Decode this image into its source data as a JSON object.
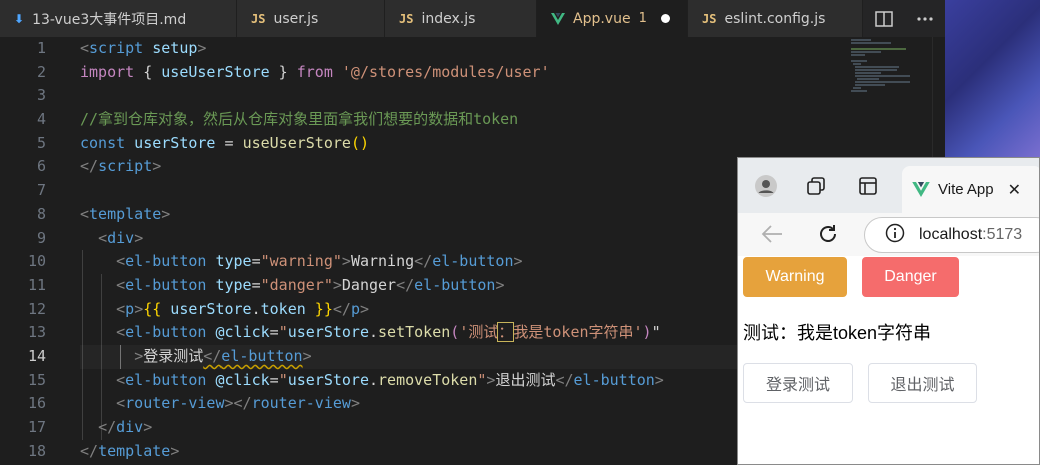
{
  "editor_tabs": [
    {
      "label": "13-vue3大事件项目.md",
      "icon": "markdown-icon"
    },
    {
      "label": "user.js",
      "icon": "js-icon",
      "badge": "JS"
    },
    {
      "label": "index.js",
      "icon": "js-icon",
      "badge": "JS"
    },
    {
      "label": "App.vue",
      "icon": "vue-icon",
      "modified_count": "1",
      "active": true
    },
    {
      "label": "eslint.config.js",
      "icon": "js-icon",
      "badge": "JS"
    }
  ],
  "tab_actions": [
    "split-editor-icon",
    "more-actions-icon"
  ],
  "line_numbers": [
    "1",
    "2",
    "3",
    "4",
    "5",
    "6",
    "7",
    "8",
    "9",
    "10",
    "11",
    "12",
    "13",
    "14",
    "15",
    "16",
    "17",
    "18"
  ],
  "current_line": "14",
  "code": {
    "l1a": "<",
    "l1b": "script",
    "l1c": " setup",
    "l1d": ">",
    "l2a": "import",
    "l2b": " { ",
    "l2c": "useUserStore",
    "l2d": " } ",
    "l2e": "from",
    "l2f": " ",
    "l2g": "'@/stores/modules/user'",
    "l4": "//拿到仓库对象，然后从仓库对象里面拿我们想要的数据和token",
    "l5a": "const",
    "l5b": " userStore",
    "l5c": " = ",
    "l5d": "useUserStore",
    "l5e": "()",
    "l6a": "</",
    "l6b": "script",
    "l6c": ">",
    "l8a": "<",
    "l8b": "template",
    "l8c": ">",
    "l9a": "<",
    "l9b": "div",
    "l9c": ">",
    "l10a": "<",
    "l10b": "el-button",
    "l10c": " type",
    "l10d": "=",
    "l10e": "\"warning\"",
    "l10f": ">",
    "l10g": "Warning",
    "l10h": "</",
    "l10i": "el-button",
    "l10j": ">",
    "l11a": "<",
    "l11b": "el-button",
    "l11c": " type",
    "l11d": "=",
    "l11e": "\"danger\"",
    "l11f": ">",
    "l11g": "Danger",
    "l11h": "</",
    "l11i": "el-button",
    "l11j": ">",
    "l12a": "<",
    "l12b": "p",
    "l12c": ">",
    "l12d": "{{",
    "l12e": " userStore",
    "l12f": ".",
    "l12g": "token",
    "l12h": " }}",
    "l12i": "</",
    "l12j": "p",
    "l12k": ">",
    "l13a": "<",
    "l13b": "el-button",
    "l13c": " @click",
    "l13d": "=",
    "l13e": "\"",
    "l13f": "userStore",
    "l13g": ".",
    "l13h": "setToken",
    "l13i": "(",
    "l13j": "'测试",
    "l13k": "：",
    "l13l": "我是token字符串'",
    "l13m": ")",
    "l13n": "\"",
    "l14a": ">",
    "l14b": "登录测试",
    "l14c": "</",
    "l14d": "el-button",
    "l14e": ">",
    "l15a": "<",
    "l15b": "el-button",
    "l15c": " @click",
    "l15d": "=",
    "l15e": "\"",
    "l15f": "userStore",
    "l15g": ".",
    "l15h": "removeToken",
    "l15i": "\"",
    "l15j": ">",
    "l15k": "退出测试",
    "l15l": "</",
    "l15m": "el-button",
    "l15n": ">",
    "l16a": "<",
    "l16b": "router-view",
    "l16c": "></",
    "l16d": "router-view",
    "l16e": ">",
    "l17a": "</",
    "l17b": "div",
    "l17c": ">",
    "l18a": "</",
    "l18b": "template",
    "l18c": ">"
  },
  "browser": {
    "tab_title": "Vite App",
    "address_host": "localhost",
    "address_port": ":5173",
    "buttons": {
      "warning": "Warning",
      "danger": "Danger",
      "login_test": "登录测试",
      "logout_test": "退出测试"
    },
    "token_text": "测试：我是token字符串"
  },
  "colors": {
    "editor_bg": "#1e1e1e",
    "tab_bar_bg": "#252526",
    "warning": "#e6a23c",
    "danger": "#f56c6c",
    "vue_green": "#41b883"
  }
}
